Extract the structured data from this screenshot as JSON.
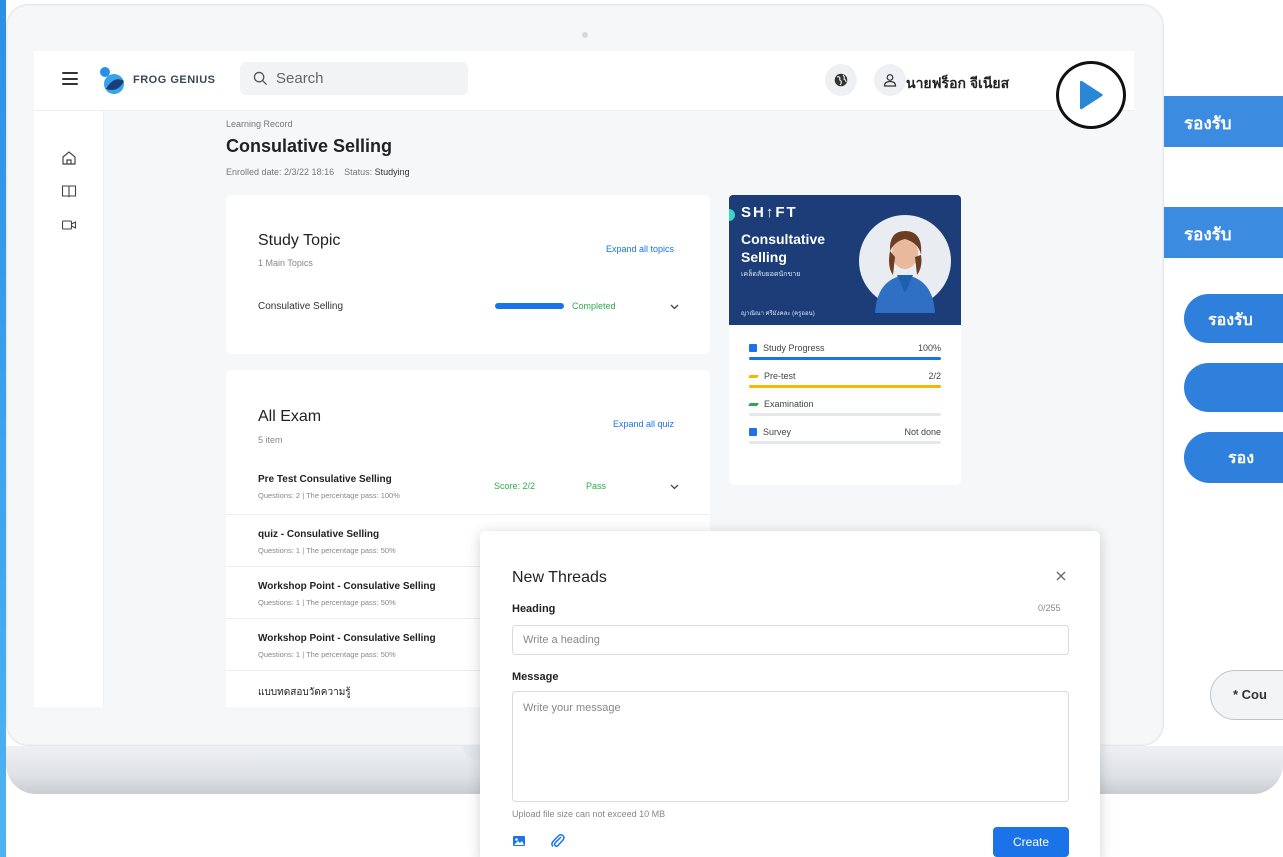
{
  "topbar": {
    "logo_text": "FROG GENIUS",
    "search_placeholder": "Search",
    "user_name": "นายฟร็อก จีเนียส"
  },
  "sidebar": {
    "items": [
      {
        "icon": "home-icon"
      },
      {
        "icon": "book-icon"
      },
      {
        "icon": "video-icon"
      }
    ]
  },
  "page": {
    "breadcrumb": "Learning Record",
    "title": "Consulative Selling",
    "enrolled_label": "Enrolled date: 2/3/22 18:16",
    "status_label": "Status:",
    "status_value": "Studying"
  },
  "study_topic": {
    "title": "Study Topic",
    "subtitle": "1 Main Topics",
    "expand_link": "Expand all topics",
    "topics": [
      {
        "name": "Consulative Selling",
        "progress": 1.0,
        "status": "Completed"
      }
    ]
  },
  "all_exam": {
    "title": "All Exam",
    "subtitle": "5 item",
    "expand_link": "Expand all quiz",
    "items": [
      {
        "title": "Pre Test Consulative Selling",
        "meta": "Questions: 2  |  The percentage pass: 100%",
        "score_label": "Score:",
        "score": "2/2",
        "result": "Pass"
      },
      {
        "title": "quiz - Consulative Selling",
        "meta": "Questions: 1  |  The percentage pass: 50%"
      },
      {
        "title": "Workshop Point - Consulative Selling",
        "meta": "Questions: 1  |  The percentage pass: 50%"
      },
      {
        "title": "Workshop Point - Consulative Selling",
        "meta": "Questions: 1  |  The percentage pass: 50%"
      },
      {
        "title": "แบบทดสอบวัดความรู้"
      }
    ]
  },
  "course_card": {
    "brand": "SH↑FT",
    "title_line1": "Consultative",
    "title_line2": "Selling",
    "tagline": "เคล็ดลับยอดนักขาย",
    "instructor": "ญาณิณา ศรีมังคละ (ครูออน)",
    "stats": [
      {
        "label": "Study Progress",
        "value": "100%",
        "fill": 1.0,
        "color": "#1a73e8",
        "icon": "book-icon",
        "icon_color": "#1a73e8"
      },
      {
        "label": "Pre-test",
        "value": "2/2",
        "fill": 1.0,
        "color": "#f5b800",
        "icon": "pencil-icon",
        "icon_color": "#f5b800"
      },
      {
        "label": "Examination",
        "value": "",
        "fill": 0.0,
        "color": "#2eaa4e",
        "icon": "pencil-icon",
        "icon_color": "#2eaa4e"
      },
      {
        "label": "Survey",
        "value": "Not done",
        "fill": 0.0,
        "color": "#1a73e8",
        "icon": "flag-icon",
        "icon_color": "#1a73e8"
      }
    ]
  },
  "side_tabs": [
    "รองรับ",
    "รองรับ",
    "รองรับ",
    "",
    "รอง"
  ],
  "note_pill": "* Cou",
  "modal": {
    "title": "New Threads",
    "heading_label": "Heading",
    "heading_counter": "0/255",
    "heading_placeholder": "Write a heading",
    "message_label": "Message",
    "message_placeholder": "Write your message",
    "upload_note": "Upload file size can not exceed 10 MB",
    "create_label": "Create"
  },
  "colors": {
    "accent": "#1a73e8",
    "success": "#2eaa4e",
    "banner": "#1c3d78",
    "side_tab": "#3b8be0"
  }
}
